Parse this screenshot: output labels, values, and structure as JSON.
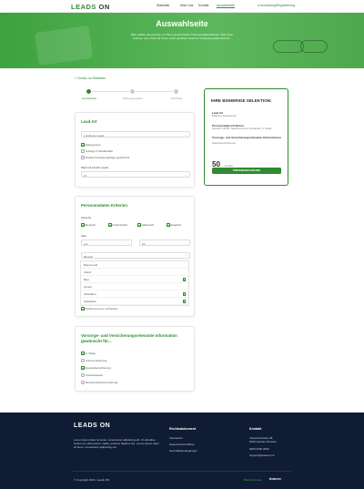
{
  "header": {
    "logo_left": "LEADS",
    "logo_right": "ON",
    "nav": [
      "Startseite",
      "Über Uns",
      "Kontakt",
      "Auswahlseite"
    ],
    "login": "Anmeldung/Registrierung"
  },
  "hero": {
    "title": "Auswahlseite",
    "subtitle": "Bitte wählen Sie jetzt die von Ihnen gewünschten Personendatenkriterien nach Ihren Kriterien aus. damit wir Ihnen einen gezielten Lead zur Verfügung stellen können."
  },
  "back_link": "« Zurück zur Startseite",
  "steps": [
    "Auswahlseite",
    "Zahlungsangaben",
    "Abschluss"
  ],
  "lead_card": {
    "title": "Lead Art",
    "select_value": "1 Exklusiv Leads",
    "checkboxes": [
      {
        "label": "Zeitsegment",
        "checked": true
      },
      {
        "label": "Anfrage im Bedarfsfall",
        "checked": false
      },
      {
        "label": "Direkte Kündigungsfrage gewünscht",
        "checked": false
      }
    ],
    "qty_label": "Maximal Anzahl Leads",
    "qty_value": "10"
  },
  "person_card": {
    "title": "Personendaten Kriterien",
    "lang_label": "Sprache",
    "languages": [
      {
        "label": "Deutsch",
        "checked": true
      },
      {
        "label": "Französisch",
        "checked": true
      },
      {
        "label": "Italienisch",
        "checked": true
      },
      {
        "label": "Englisch",
        "checked": true
      }
    ],
    "age_label": "Alter",
    "age_from": "von",
    "age_to": "bis",
    "region_placeholder": "Bereich",
    "regions": [
      {
        "label": "Basel-Land",
        "checked": false
      },
      {
        "label": "Zürich",
        "checked": false
      },
      {
        "label": "Bern",
        "checked": true
      },
      {
        "label": "Luzern",
        "checked": false
      },
      {
        "label": "Obwalden",
        "checked": true
      },
      {
        "label": "Nidwalden",
        "checked": true
      }
    ],
    "phone_label": "Telefonnummer vorhanden"
  },
  "insurance_card": {
    "title": "Vorsorge- und Versicherungsrelevante Information gewünscht für...",
    "items": [
      {
        "label": "3. Säule",
        "checked": true
      },
      {
        "label": "Autoversicherung",
        "checked": false
      },
      {
        "label": "Hausratversicherung",
        "checked": true
      },
      {
        "label": "Krankenkasse",
        "checked": false
      },
      {
        "label": "Rechtsschutzversicherung",
        "checked": false
      }
    ]
  },
  "summary": {
    "title": "IHRE BISHERIGE SELEKTION:",
    "lead_art_label": "Lead Art",
    "lead_art_value": "Exklusiv, Zeitsegment",
    "person_label": "Personendaten Kriterien",
    "person_value": "Deutsch, 30-50, Telefonnummer vorhanden, 3. Säule",
    "insurance_label": "Vorsorge- und Versicherungsrelevante Informationen",
    "insurance_value": "Hausratversicherung",
    "amount": "50",
    "currency": "Credits",
    "button": "PREISBERECHNUNG"
  },
  "footer": {
    "logo_left": "LEADS",
    "logo_right": "ON",
    "desc": "Lorem ipsum dolor sit amet, consectetur adipiscing elit. Ut elit tellus, luctus nec ullamcorper mattis, pulvinar dapibus leo. Lorem ipsum dolor sit amet, consectetur adipiscing elit.",
    "legal_title": "Rechtsdokument",
    "legal": [
      "Impressum",
      "Datenschutzrichtlinie",
      "Geschäftsbedingungen"
    ],
    "contact_title": "Kontakt",
    "contact": [
      "Industriestrasse 28,",
      "9100 Herisau Schweiz",
      "0000 0000 0000",
      "support@leadson.ch"
    ],
    "copyright": "© Copyright 2021 | Leads ON",
    "built_by": "Built by Innovo",
    "partner_logo": "innovo"
  }
}
